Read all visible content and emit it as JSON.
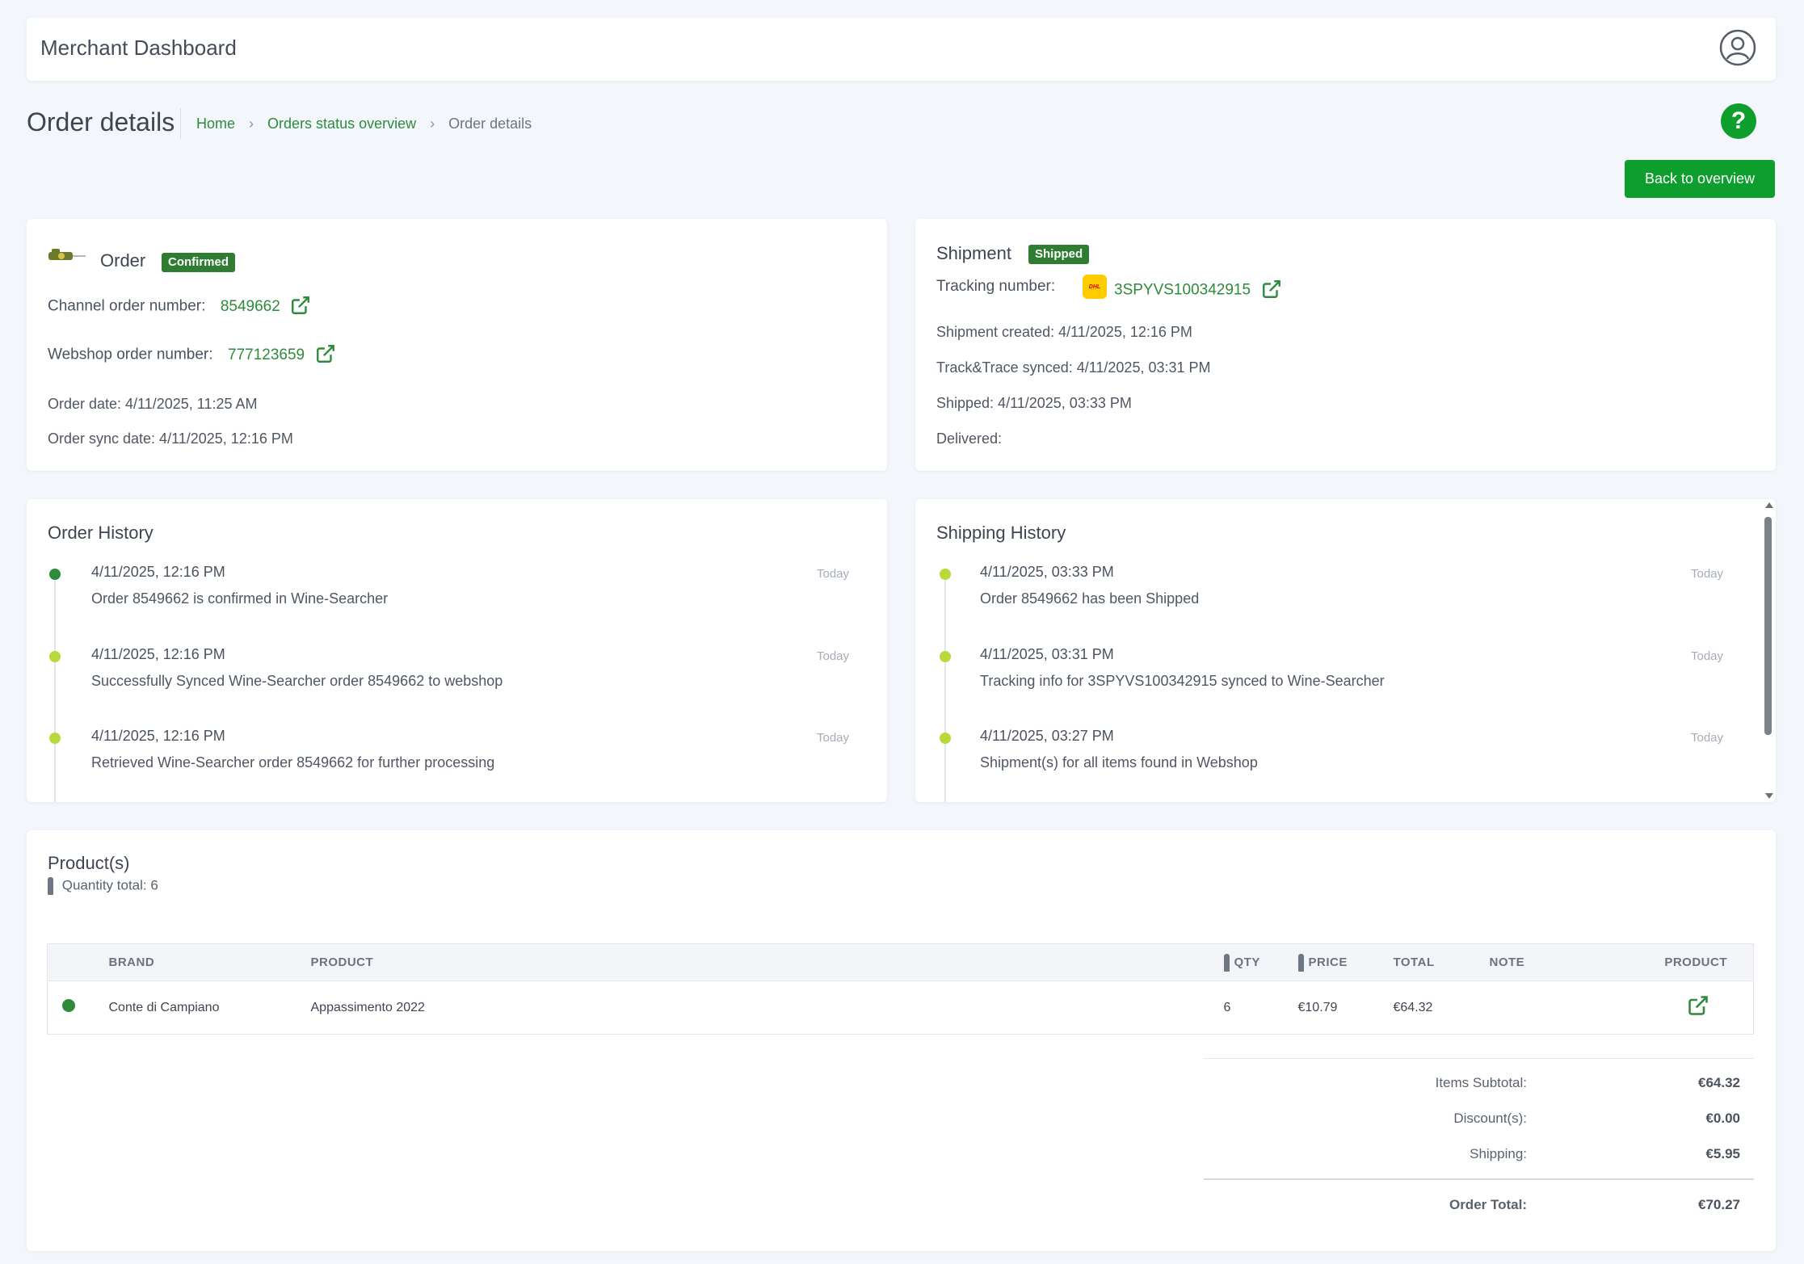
{
  "app": {
    "title": "Merchant Dashboard"
  },
  "page": {
    "title": "Order details",
    "breadcrumb": [
      "Home",
      "Orders status overview",
      "Order details"
    ],
    "help_label": "?",
    "back_button": "Back to overview"
  },
  "order": {
    "title": "Order",
    "status_badge": "Confirmed",
    "channel_label": "Channel order number:",
    "channel_number": "8549662",
    "webshop_label": "Webshop order number:",
    "webshop_number": "777123659",
    "order_date": "Order date: 4/11/2025, 11:25 AM",
    "sync_date": "Order sync date: 4/11/2025, 12:16 PM"
  },
  "shipment": {
    "title": "Shipment",
    "status_badge": "Shipped",
    "tracking_label": "Tracking number:",
    "carrier_icon": "dhl-logo",
    "tracking_number": "3SPYVS100342915",
    "created": "Shipment created: 4/11/2025, 12:16 PM",
    "synced": "Track&Trace synced: 4/11/2025, 03:31 PM",
    "shipped": "Shipped: 4/11/2025, 03:33 PM",
    "delivered": "Delivered:"
  },
  "order_history": {
    "title": "Order History",
    "entries": [
      {
        "time": "4/11/2025, 12:16 PM",
        "message": "Order 8549662 is confirmed in Wine-Searcher",
        "day": "Today",
        "color": "#2e8b3a"
      },
      {
        "time": "4/11/2025, 12:16 PM",
        "message": "Successfully Synced Wine-Searcher order 8549662 to webshop",
        "day": "Today",
        "color": "#b8d93a"
      },
      {
        "time": "4/11/2025, 12:16 PM",
        "message": "Retrieved Wine-Searcher order 8549662 for further processing",
        "day": "Today",
        "color": "#b8d93a"
      }
    ]
  },
  "shipping_history": {
    "title": "Shipping History",
    "entries": [
      {
        "time": "4/11/2025, 03:33 PM",
        "message": "Order 8549662 has been Shipped",
        "day": "Today",
        "color": "#b8d93a"
      },
      {
        "time": "4/11/2025, 03:31 PM",
        "message": "Tracking info for 3SPYVS100342915 synced to Wine-Searcher",
        "day": "Today",
        "color": "#b8d93a"
      },
      {
        "time": "4/11/2025, 03:27 PM",
        "message": "Shipment(s) for all items found in Webshop",
        "day": "Today",
        "color": "#b8d93a"
      }
    ]
  },
  "products": {
    "title": "Product(s)",
    "quantity_total": "Quantity total: 6",
    "columns": {
      "brand": "BRAND",
      "product": "PRODUCT",
      "qty": "QTY",
      "price": "PRICE",
      "total": "TOTAL",
      "note": "NOTE",
      "link": "PRODUCT"
    },
    "rows": [
      {
        "brand": "Conte di Campiano",
        "product": "Appassimento 2022",
        "qty": "6",
        "price": "€10.79",
        "total": "€64.32",
        "note": ""
      }
    ],
    "totals": {
      "subtotal_label": "Items Subtotal:",
      "subtotal": "€64.32",
      "discount_label": "Discount(s):",
      "discount": "€0.00",
      "shipping_label": "Shipping:",
      "shipping": "€5.95",
      "order_total_label": "Order Total:",
      "order_total": "€70.27"
    }
  },
  "colors": {
    "accent": "#0e9e2e",
    "link": "#2e8b3a",
    "badge": "#2e7d32",
    "timeline_done": "#2e8b3a",
    "timeline_pending": "#b8d93a"
  }
}
